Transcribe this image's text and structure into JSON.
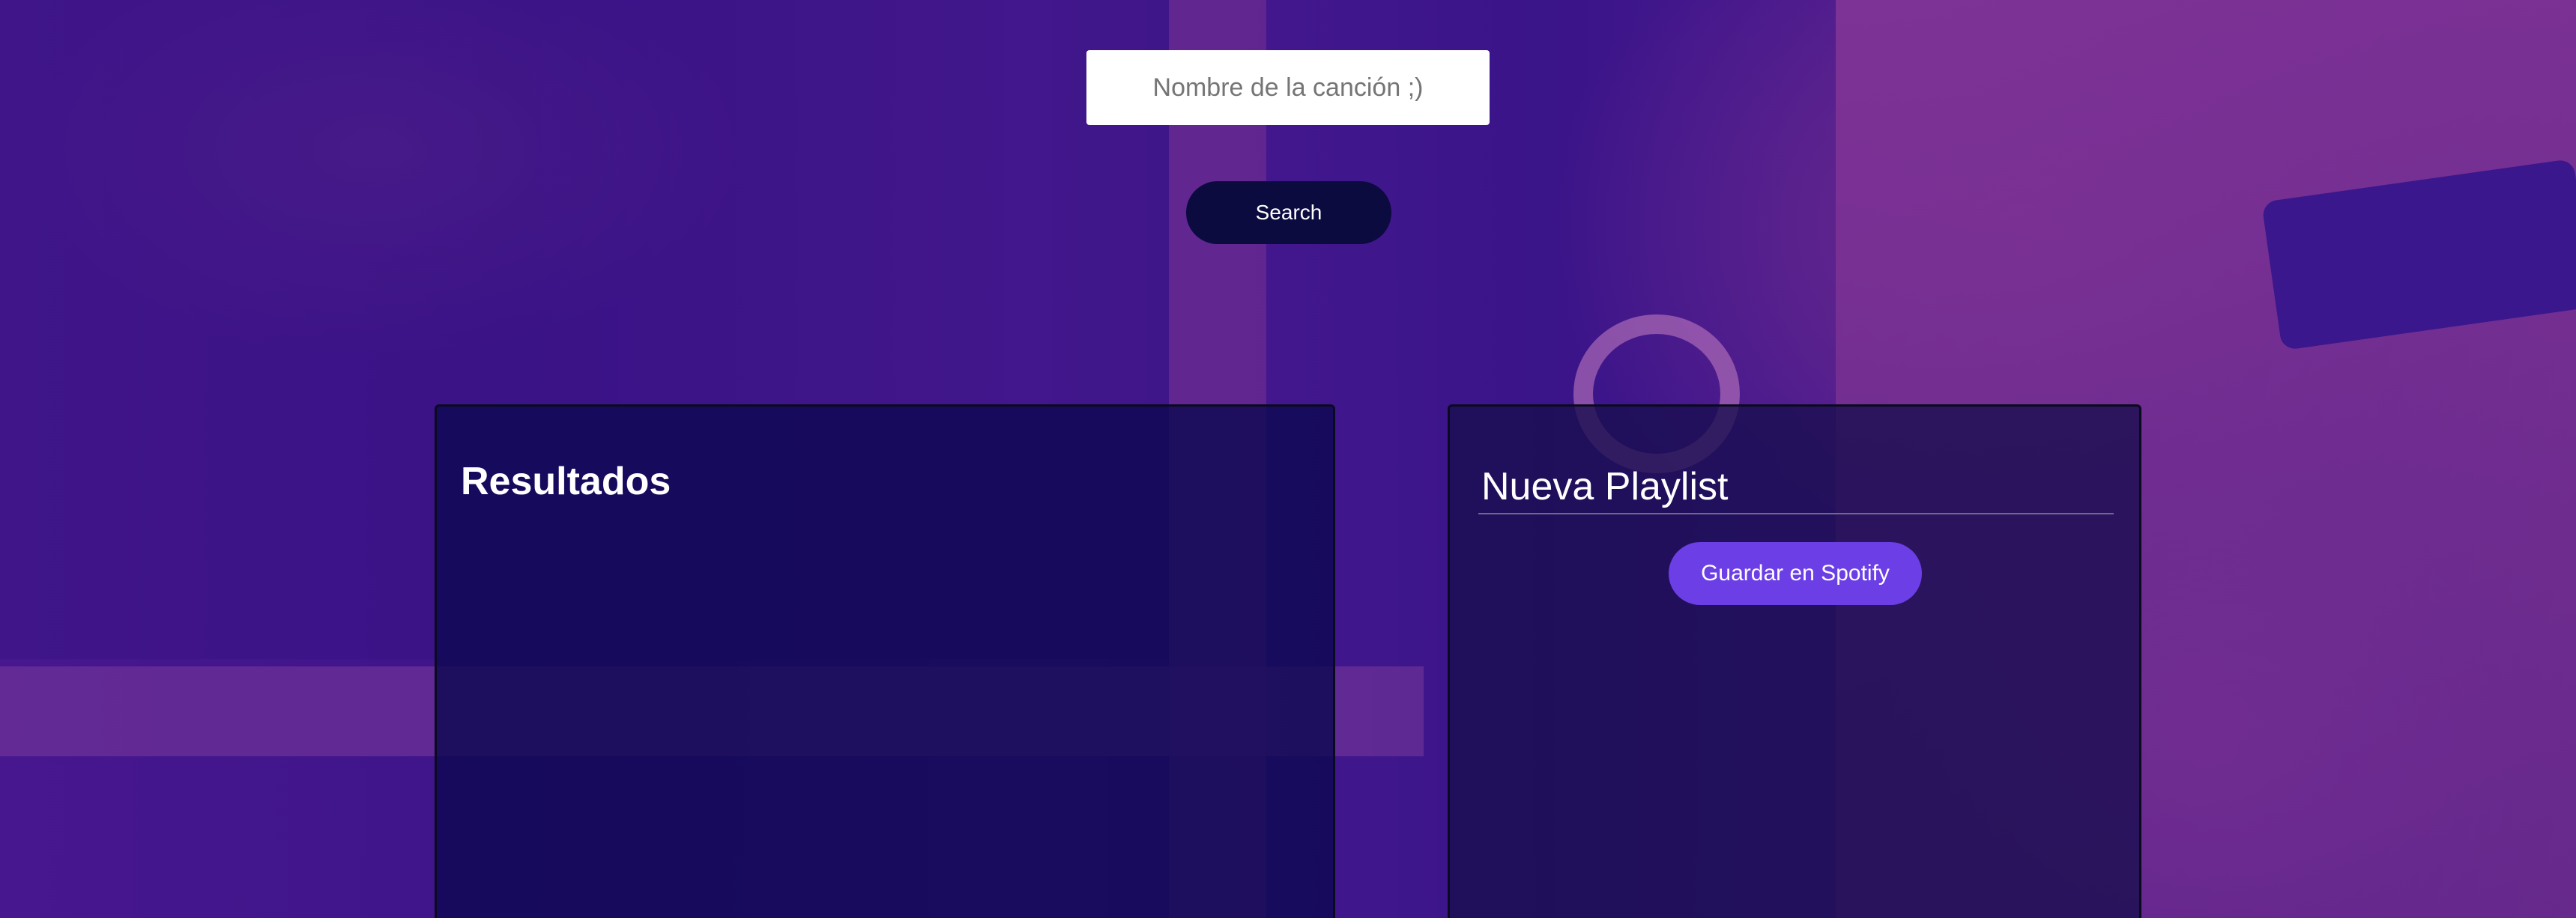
{
  "search": {
    "placeholder": "Nombre de la canción ;)",
    "value": "",
    "button_label": "Search"
  },
  "results": {
    "title": "Resultados",
    "tracks": []
  },
  "playlist": {
    "name": "Nueva Playlist",
    "save_label": "Guardar en Spotify",
    "tracks": []
  },
  "colors": {
    "background": "#3f1690",
    "search_button": "#0b0b40",
    "save_button": "#6c3ee6",
    "text": "#ffffff"
  }
}
